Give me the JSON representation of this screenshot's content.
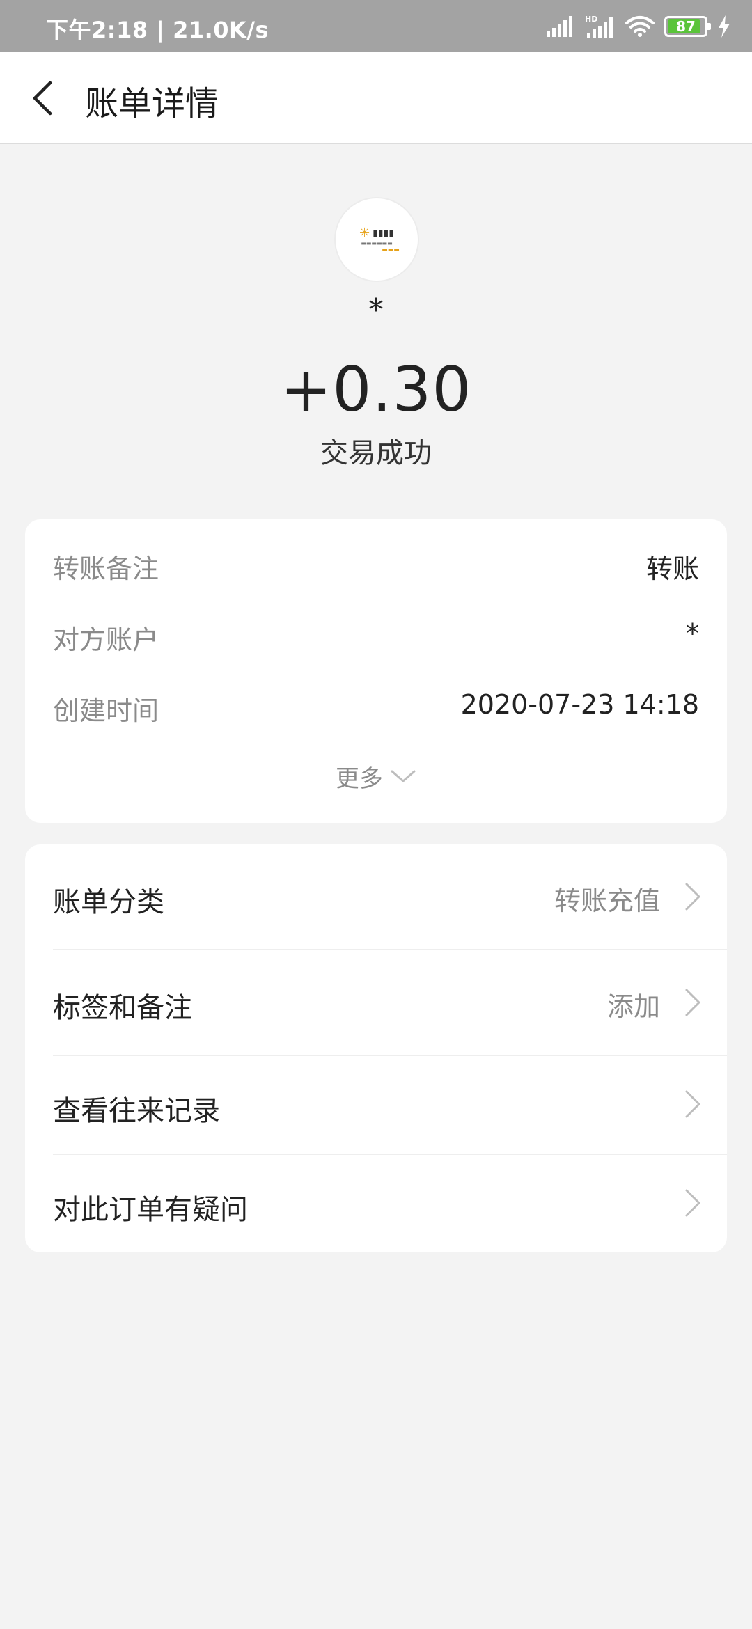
{
  "status_bar": {
    "time_speed": "下午2:18 | 21.0K/s",
    "battery_level": "87",
    "icons": [
      "signal-icon",
      "hd-signal-icon",
      "wifi-icon",
      "battery-icon",
      "charging-icon"
    ]
  },
  "header": {
    "title": "账单详情"
  },
  "transaction": {
    "merchant_name": "*",
    "amount": "+0.30",
    "status": "交易成功"
  },
  "details": {
    "rows": [
      {
        "key": "转账备注",
        "value": "转账"
      },
      {
        "key": "对方账户",
        "value": "*"
      },
      {
        "key": "创建时间",
        "value": "2020-07-23 14:18"
      }
    ],
    "more_label": "更多"
  },
  "menu": {
    "items": [
      {
        "label": "账单分类",
        "value": "转账充值"
      },
      {
        "label": "标签和备注",
        "value": "添加"
      },
      {
        "label": "查看往来记录",
        "value": ""
      },
      {
        "label": "对此订单有疑问",
        "value": ""
      }
    ]
  },
  "colors": {
    "background": "#f3f3f3",
    "status_bar": "#a3a3a3",
    "battery_fill": "#5ac43a",
    "logo_accent": "#e6a21a"
  }
}
